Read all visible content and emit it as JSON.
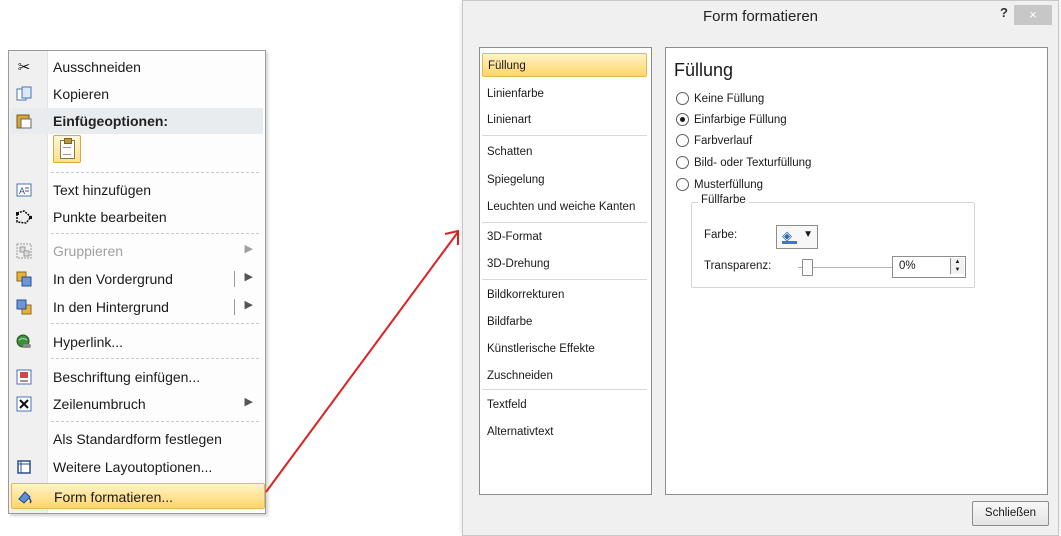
{
  "context_menu": {
    "items": [
      {
        "label": "Ausschneiden",
        "icon": "scissors-icon"
      },
      {
        "label": "Kopieren",
        "icon": "copy-icon"
      },
      {
        "label": "Einfügeoptionen:",
        "icon": "paste-icon"
      },
      {
        "label": "Text hinzufügen",
        "icon": "text-box-icon"
      },
      {
        "label": "Punkte bearbeiten",
        "icon": "edit-points-icon"
      },
      {
        "label": "Gruppieren",
        "icon": "group-icon"
      },
      {
        "label": "In den Vordergrund",
        "icon": "bring-forward-icon"
      },
      {
        "label": "In den Hintergrund",
        "icon": "send-backward-icon"
      },
      {
        "label": "Hyperlink...",
        "icon": "hyperlink-icon"
      },
      {
        "label": "Beschriftung einfügen...",
        "icon": "caption-icon"
      },
      {
        "label": "Zeilenumbruch",
        "icon": "text-wrap-icon"
      },
      {
        "label": "Als Standardform festlegen",
        "icon": ""
      },
      {
        "label": "Weitere Layoutoptionen...",
        "icon": "layout-options-icon"
      },
      {
        "label": "Form formatieren...",
        "icon": "format-shape-icon"
      }
    ]
  },
  "dialog": {
    "title": "Form formatieren",
    "help_label": "?",
    "close_label": "×",
    "nav": [
      "Füllung",
      "Linienfarbe",
      "Linienart",
      "Schatten",
      "Spiegelung",
      "Leuchten und weiche Kanten",
      "3D-Format",
      "3D-Drehung",
      "Bildkorrekturen",
      "Bildfarbe",
      "Künstlerische Effekte",
      "Zuschneiden",
      "Textfeld",
      "Alternativtext"
    ],
    "content": {
      "heading": "Füllung",
      "options": [
        "Keine Füllung",
        "Einfarbige Füllung",
        "Farbverlauf",
        "Bild- oder Texturfüllung",
        "Musterfüllung"
      ],
      "selected_option": "Einfarbige Füllung",
      "group_label": "Füllfarbe",
      "color_label": "Farbe:",
      "transparency_label": "Transparenz:",
      "transparency_value": "0%"
    },
    "button_close": "Schließen"
  },
  "colors": {
    "highlight": "#ffd56b",
    "arrow": "#e02020"
  }
}
